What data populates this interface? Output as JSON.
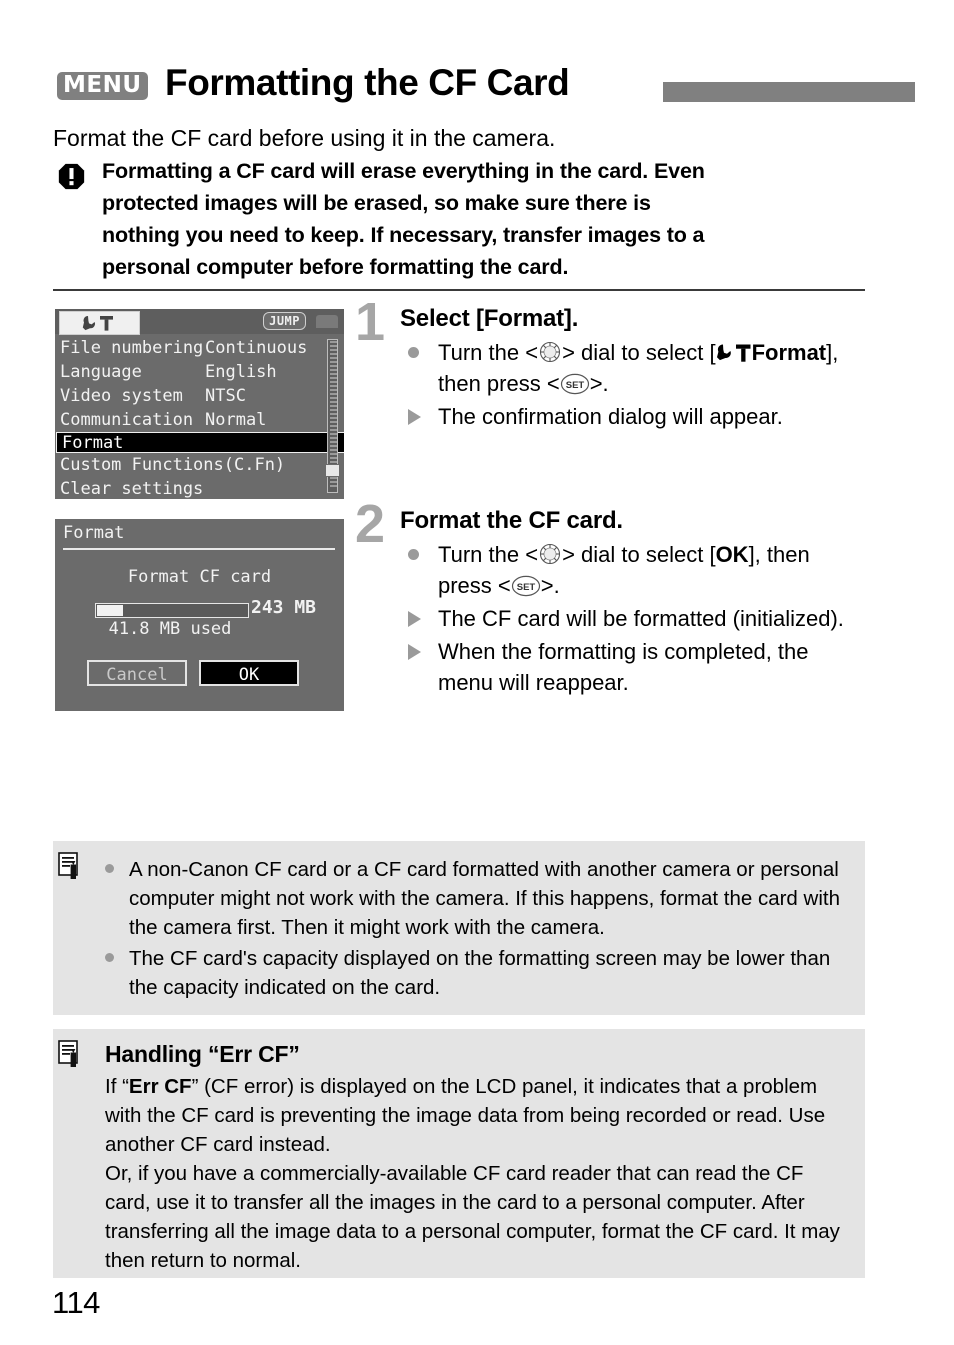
{
  "header": {
    "menu_badge": "MENU",
    "title": "Formatting the CF Card"
  },
  "intro": "Format the CF card before using it in the camera.",
  "caution": {
    "icon": "warning-icon",
    "lines": [
      "Formatting a CF card will erase everything in the card. Even",
      "protected images will be erased, so make sure there is",
      "nothing you need to keep. If necessary, transfer images to a",
      "personal computer before formatting the card."
    ]
  },
  "lcd_menu": {
    "tab_icon": "setup-tools-icon",
    "jump_label": "JUMP",
    "rows": [
      {
        "label": "File numbering",
        "value": "Continuous"
      },
      {
        "label": "Language",
        "value": "English"
      },
      {
        "label": "Video system",
        "value": "NTSC"
      },
      {
        "label": "Communication",
        "value": "Normal"
      },
      {
        "label": "Format",
        "value": ""
      },
      {
        "label": "Custom Functions(C.Fn)",
        "value": ""
      },
      {
        "label": "Clear settings",
        "value": ""
      }
    ],
    "selected_row": "Format"
  },
  "lcd_format": {
    "title": "Format",
    "message": "Format CF card",
    "capacity": "243 MB",
    "used": "41.8 MB used",
    "used_percent": 17,
    "cancel_label": "Cancel",
    "ok_label": "OK",
    "selected_button": "OK"
  },
  "steps": [
    {
      "number": "1",
      "heading": "Select [Format].",
      "items": [
        {
          "type": "dot",
          "parts": [
            {
              "t": "text",
              "v": "Turn the <"
            },
            {
              "t": "icon",
              "v": "dial-icon"
            },
            {
              "t": "text",
              "v": "> dial to select ["
            },
            {
              "t": "icon",
              "v": "setup-tools-icon"
            },
            {
              "t": "bold",
              "v": " Format"
            },
            {
              "t": "text",
              "v": "], then press <"
            },
            {
              "t": "icon",
              "v": "set-button-icon"
            },
            {
              "t": "text",
              "v": ">."
            }
          ],
          "plain": "Turn the < > dial to select [ Format], then press <SET>."
        },
        {
          "type": "triangle",
          "plain": "The confirmation dialog will appear."
        }
      ]
    },
    {
      "number": "2",
      "heading": "Format the CF card.",
      "items": [
        {
          "type": "dot",
          "plain": "Turn the < > dial to select [OK], then press <SET>."
        },
        {
          "type": "triangle",
          "plain": "The CF card will be formatted (initialized)."
        },
        {
          "type": "triangle",
          "plain": "When the formatting is completed, the menu will reappear."
        }
      ]
    }
  ],
  "note_box_1": {
    "icon": "note-pen-icon",
    "items": [
      "A non-Canon CF card or a CF card formatted with another camera or personal computer might not work with the camera. If this happens, format the card with the camera first. Then it might work with the camera.",
      "The CF card's capacity displayed on the formatting screen may be lower than the capacity indicated on the card."
    ]
  },
  "note_box_2": {
    "icon": "note-pen-icon",
    "title": "Handling “Err CF”",
    "paragraph_1_pre": "If “",
    "paragraph_1_bold": "Err CF",
    "paragraph_1_post": "” (CF error) is displayed on the LCD panel, it indicates that a problem with the CF card is preventing the image data from being recorded or read. Use another CF card instead.",
    "paragraph_2": "Or, if you have a commercially-available CF card reader that can read the CF card, use it to transfer all the images in the card to a personal computer. After transferring all the image data to a personal computer, format the CF card. It may then return to normal."
  },
  "page_number": "114",
  "colors": {
    "accent_gray": "#808080",
    "step_number_gray": "#a6a6a6",
    "note_box_bg": "#e4e4e4",
    "lcd_bg": "#6b6b6b"
  }
}
